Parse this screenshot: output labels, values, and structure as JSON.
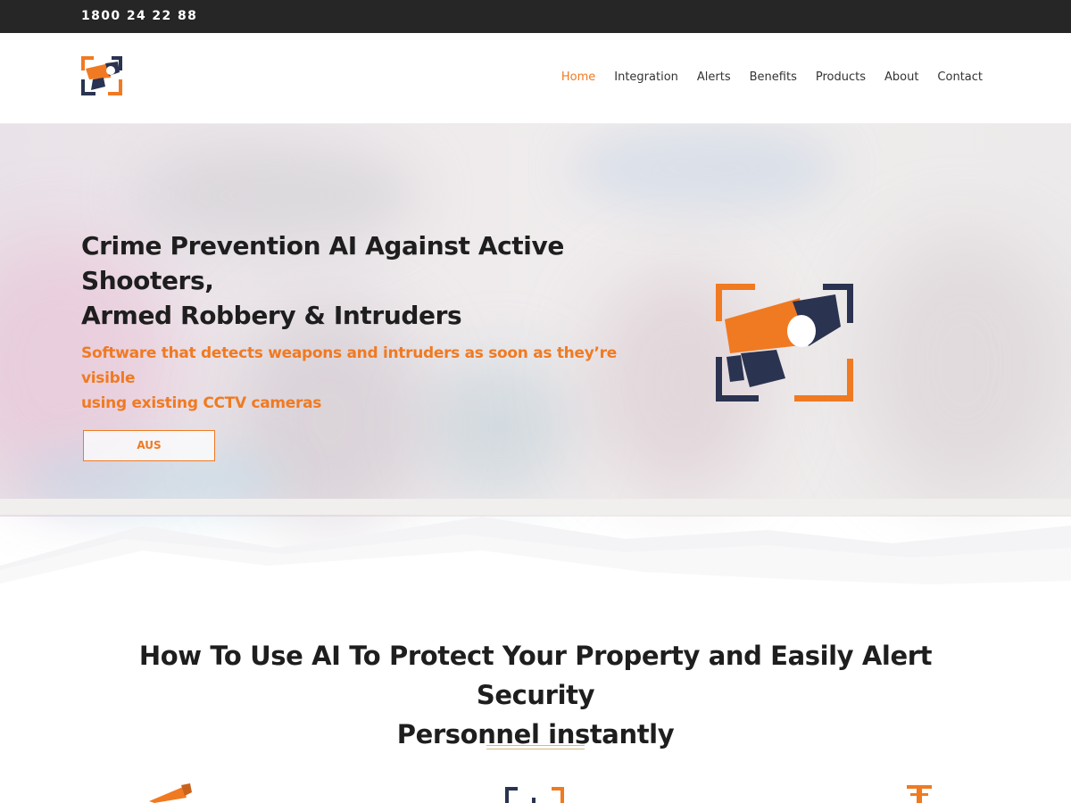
{
  "topbar": {
    "phone": "1800 24 22 88"
  },
  "nav": {
    "items": [
      {
        "label": "Home",
        "active": true
      },
      {
        "label": "Integration",
        "active": false
      },
      {
        "label": "Alerts",
        "active": false
      },
      {
        "label": "Benefits",
        "active": false
      },
      {
        "label": "Products",
        "active": false
      },
      {
        "label": "About",
        "active": false
      },
      {
        "label": "Contact",
        "active": false
      }
    ]
  },
  "hero": {
    "title_line1": "Crime Prevention AI Against Active Shooters,",
    "title_line2": "Armed Robbery & Intruders",
    "subtitle_line1": "Software that detects weapons and intruders as soon as they’re visible",
    "subtitle_line2": "using existing CCTV cameras",
    "button_label": "AUS"
  },
  "section": {
    "title_line1": "How To Use AI To Protect Your Property and Easily Alert Security",
    "title_line2": "Personnel instantly"
  },
  "colors": {
    "accent": "#f07a22",
    "navy": "#2a3350",
    "topbar": "#262626",
    "divider": "#d9b87a"
  },
  "icons": [
    "camera-logo-icon",
    "camera-feature-icon",
    "frame-feature-icon",
    "alert-feature-icon"
  ]
}
